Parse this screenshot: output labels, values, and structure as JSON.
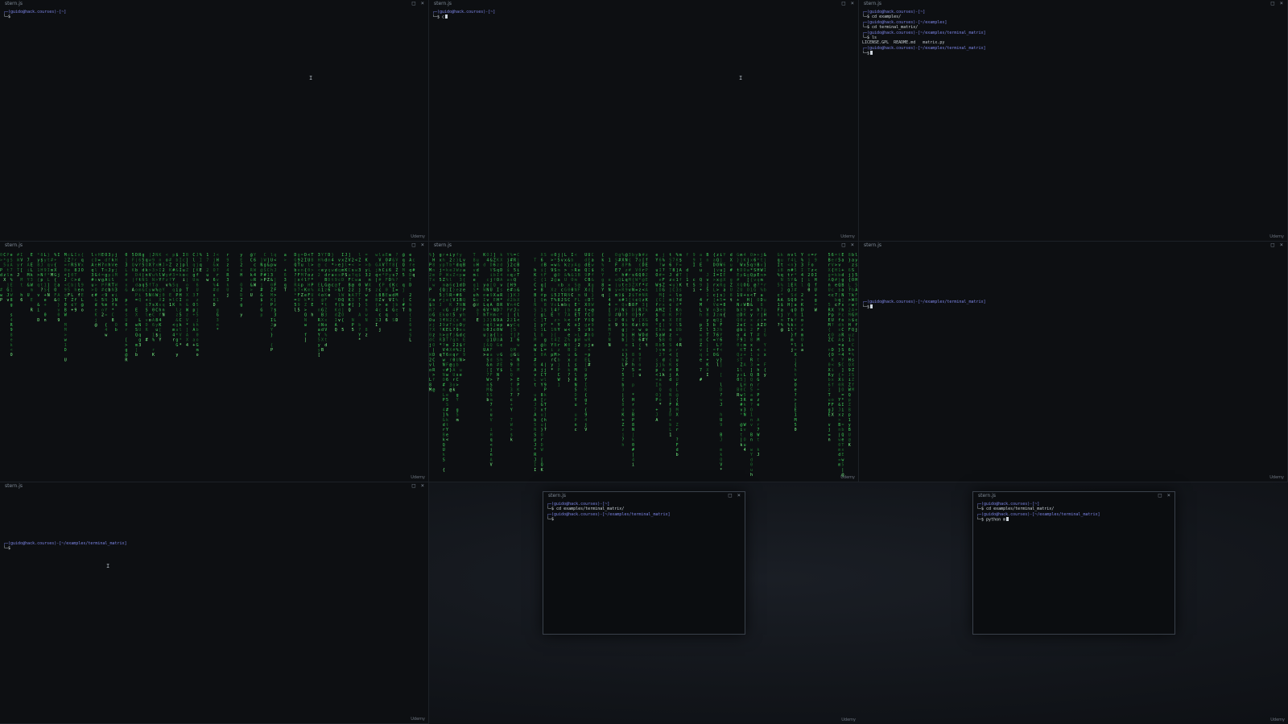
{
  "brand": "Udemy",
  "title": "stern.js",
  "controls": {
    "maximize_glyph": "□",
    "close_glyph": "×",
    "ibeam_glyph": "I"
  },
  "colors": {
    "prompt": "#7d86e8",
    "rain_bright": "#7dff8a",
    "rain_mid": "#3fd35a",
    "rain_dim": "#1f7a30"
  },
  "windows": [
    {
      "id": "w1",
      "lines": [
        {
          "parts": [
            {
              "t": "┌─(guido@hack.courses)-[~]",
              "c": "prompt"
            }
          ]
        },
        {
          "parts": [
            {
              "t": "└─$",
              "c": "cmd"
            }
          ]
        }
      ]
    },
    {
      "id": "w2",
      "lines": [
        {
          "parts": [
            {
              "t": "┌─(guido@hack.courses)-[~]",
              "c": "prompt"
            }
          ]
        },
        {
          "parts": [
            {
              "t": "└─$ c",
              "c": "cmd"
            }
          ],
          "cursor": true
        }
      ]
    },
    {
      "id": "w3",
      "lines": [
        {
          "parts": [
            {
              "t": "┌─(guido@hack.courses)-[~]",
              "c": "prompt"
            }
          ]
        },
        {
          "parts": [
            {
              "t": "└─$ cd examples/",
              "c": "cmd"
            }
          ]
        },
        {
          "parts": [
            {
              "t": "┌─(guido@hack.courses)-[~/examples]",
              "c": "prompt"
            }
          ]
        },
        {
          "parts": [
            {
              "t": "└─$ cd terminal_matrix/",
              "c": "cmd"
            }
          ]
        },
        {
          "parts": [
            {
              "t": "┌─(guido@hack.courses)-[~/examples/terminal_matrix]",
              "c": "prompt"
            }
          ]
        },
        {
          "parts": [
            {
              "t": "└─$ ls",
              "c": "cmd"
            }
          ]
        },
        {
          "parts": [
            {
              "t": "LICENSE.GPL  README.md   matrix.py",
              "c": "plain"
            }
          ]
        },
        {
          "parts": [
            {
              "t": "┌─(guido@hack.courses)-[~/examples/terminal_matrix]",
              "c": "prompt"
            }
          ]
        },
        {
          "parts": [
            {
              "t": "└─$",
              "c": "cmd"
            }
          ],
          "cursor": true
        }
      ]
    },
    {
      "id": "w4",
      "lines": []
    },
    {
      "id": "w5",
      "lines": []
    },
    {
      "id": "w6",
      "lines": [
        {
          "parts": [
            {
              "t": "┌─(guido@hack.courses)-[~/examples/terminal_matrix]",
              "c": "prompt"
            }
          ]
        },
        {
          "parts": [
            {
              "t": "└─$",
              "c": "cmd"
            }
          ],
          "cursor": true
        }
      ]
    },
    {
      "id": "w7",
      "lines": [
        {
          "parts": [
            {
              "t": "┌─(guido@hack.courses)-[~/examples/terminal_matrix]",
              "c": "prompt"
            }
          ]
        },
        {
          "parts": [
            {
              "t": "└─$",
              "c": "cmd"
            }
          ]
        }
      ]
    },
    {
      "id": "w8",
      "lines": [
        {
          "parts": [
            {
              "t": "┌─(guido@hack.courses)-[~]",
              "c": "prompt"
            }
          ]
        },
        {
          "parts": [
            {
              "t": "└─$ cd examples/terminal_matrix/",
              "c": "cmd"
            }
          ]
        },
        {
          "parts": [
            {
              "t": "┌─(guido@hack.courses)-[~/examples/terminal_matrix]",
              "c": "prompt"
            }
          ]
        },
        {
          "parts": [
            {
              "t": "└─$",
              "c": "cmd"
            }
          ]
        }
      ]
    },
    {
      "id": "w9",
      "lines": [
        {
          "parts": [
            {
              "t": "┌─(guido@hack.courses)-[~]",
              "c": "prompt"
            }
          ]
        },
        {
          "parts": [
            {
              "t": "└─$ cd examples/terminal_matrix/",
              "c": "cmd"
            }
          ]
        },
        {
          "parts": [
            {
              "t": "┌─(guido@hack.courses)-[~/examples/terminal_matrix]",
              "c": "prompt"
            }
          ]
        },
        {
          "parts": [
            {
              "t": "└─$ python m",
              "c": "cmd"
            }
          ],
          "cursor": true
        }
      ]
    }
  ]
}
